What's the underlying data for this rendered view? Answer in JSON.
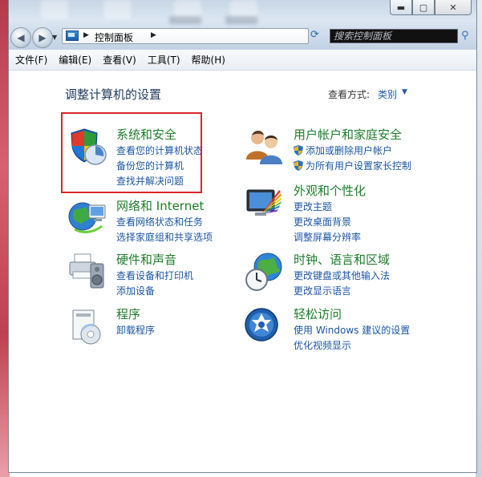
{
  "address": {
    "path": "控制面板"
  },
  "search": {
    "placeholder": "搜索控制面板"
  },
  "menu": [
    "文件(F)",
    "编辑(E)",
    "查看(V)",
    "工具(T)",
    "帮助(H)"
  ],
  "header": {
    "title": "调整计算机的设置",
    "view_label": "查看方式:",
    "view_value": "类别"
  },
  "categories": [
    {
      "title": "系统和安全",
      "links": [
        "查看您的计算机状态",
        "备份您的计算机",
        "查找并解决问题"
      ]
    },
    {
      "title": "网络和 Internet",
      "links": [
        "查看网络状态和任务",
        "选择家庭组和共享选项"
      ]
    },
    {
      "title": "硬件和声音",
      "links": [
        "查看设备和打印机",
        "添加设备"
      ]
    },
    {
      "title": "程序",
      "links": [
        "卸载程序"
      ]
    },
    {
      "title": "用户帐户和家庭安全",
      "links": [
        "添加或删除用户帐户",
        "为所有用户设置家长控制"
      ]
    },
    {
      "title": "外观和个性化",
      "links": [
        "更改主题",
        "更改桌面背景",
        "调整屏幕分辨率"
      ]
    },
    {
      "title": "时钟、语言和区域",
      "links": [
        "更改键盘或其他输入法",
        "更改显示语言"
      ]
    },
    {
      "title": "轻松访问",
      "links": [
        "使用 Windows 建议的设置",
        "优化视频显示"
      ]
    }
  ],
  "colors": {
    "category_title": "#1e7d2a",
    "link": "#1b55a3",
    "highlight": "#d8272c"
  }
}
